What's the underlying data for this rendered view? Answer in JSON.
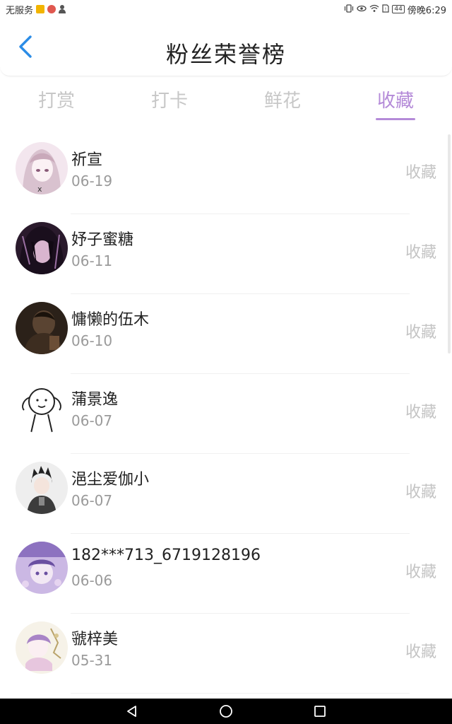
{
  "status_bar": {
    "carrier": "无服务",
    "battery": "44",
    "time": "傍晚6:29"
  },
  "header": {
    "title": "粉丝荣誉榜"
  },
  "tabs": [
    {
      "label": "打赏"
    },
    {
      "label": "打卡"
    },
    {
      "label": "鲜花"
    },
    {
      "label": "收藏"
    }
  ],
  "active_tab": "收藏",
  "colors": {
    "accent": "#b48ad8",
    "back_arrow": "#2b8ce6"
  },
  "fans": [
    {
      "name": "祈宣",
      "date": "06-19",
      "action": "收藏"
    },
    {
      "name": "妤子蜜糖",
      "date": "06-11",
      "action": "收藏"
    },
    {
      "name": "慵懒的伍木",
      "date": "06-10",
      "action": "收藏"
    },
    {
      "name": "蒲景逸",
      "date": "06-07",
      "action": "收藏"
    },
    {
      "name": "浥尘爱伽小",
      "date": "06-07",
      "action": "收藏"
    },
    {
      "name": "182***713_6719128196",
      "date": "06-06",
      "action": "收藏"
    },
    {
      "name": "虢梓美",
      "date": "05-31",
      "action": "收藏"
    }
  ]
}
